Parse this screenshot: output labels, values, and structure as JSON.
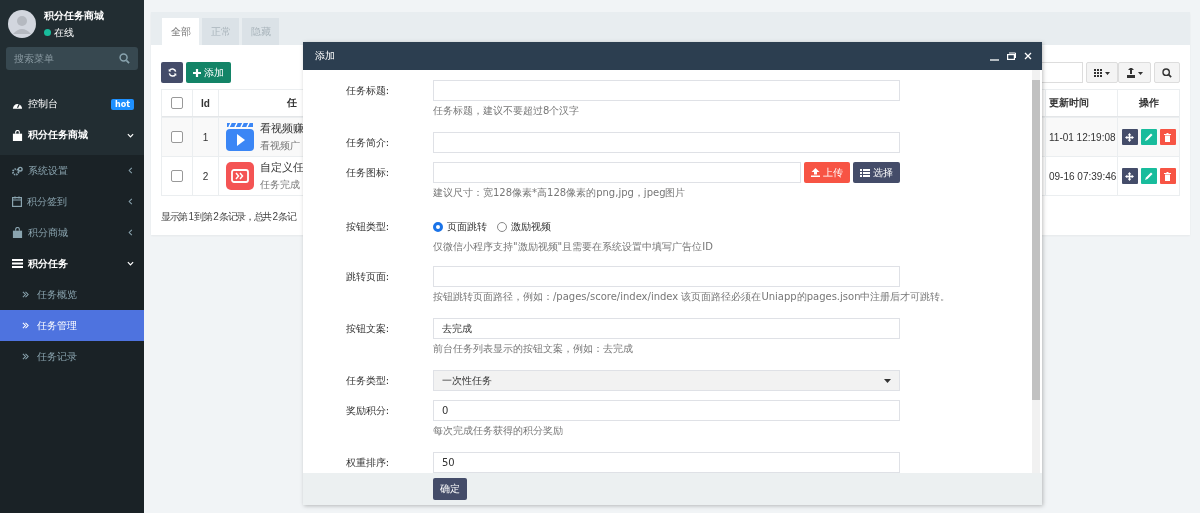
{
  "sidebar": {
    "user": {
      "name": "积分任务商城",
      "status": "在线",
      "online": true
    },
    "search": {
      "placeholder": "搜索菜单"
    },
    "menu": [
      {
        "label": "控制台",
        "badge": "hot",
        "expanded": false,
        "selected": false
      },
      {
        "label": "积分任务商城",
        "kind": "header",
        "expanded": true,
        "selected": false
      },
      {
        "label": "系统设置",
        "expanded": false,
        "selected": false
      },
      {
        "label": "积分签到",
        "expanded": false,
        "selected": false
      },
      {
        "label": "积分商城",
        "expanded": false,
        "selected": false
      },
      {
        "label": "积分任务",
        "expanded": true,
        "selected": false,
        "children": [
          {
            "label": "任务概览",
            "selected": false
          },
          {
            "label": "任务管理",
            "selected": true
          },
          {
            "label": "任务记录",
            "selected": false
          }
        ]
      }
    ]
  },
  "tabs": [
    {
      "label": "全部",
      "selected": true
    },
    {
      "label": "正常",
      "selected": false
    },
    {
      "label": "隐藏",
      "selected": false
    }
  ],
  "toolbar": {
    "add_label": "添加"
  },
  "table": {
    "header_checked": false,
    "columns": [
      "Id",
      "任",
      "更新时间",
      "操作"
    ],
    "rows": [
      {
        "checked": false,
        "id": "1",
        "title": "看视频赚",
        "desc": "看视频广",
        "time": "11-01 12:19:08",
        "kind": "video",
        "color": "#3b86f5"
      },
      {
        "checked": false,
        "id": "2",
        "title": "自定义任",
        "desc": "任务完成",
        "time": "09-16 07:39:46",
        "kind": "custom",
        "color": "#f45454"
      }
    ]
  },
  "pagination_info": "显示第 1 到第 2 条记录，总共 2 条记",
  "modal": {
    "title": "添加",
    "fields": [
      {
        "kind": "input",
        "label": "任务标题:",
        "help": "任务标题，建议不要超过8个汉字"
      },
      {
        "kind": "input",
        "label": "任务简介:"
      },
      {
        "kind": "upload",
        "label": "任务图标:",
        "buttons": [
          "上传",
          "选择"
        ],
        "help": "建议尺寸：宽128像素*高128像素的png,jpg，jpeg图片"
      },
      {
        "kind": "radio",
        "label": "按钮类型:",
        "options": [
          {
            "label": "页面跳转",
            "selected": true
          },
          {
            "label": "激励视频",
            "selected": false
          }
        ],
        "help": "仅微信小程序支持\"激励视频\"且需要在系统设置中填写广告位ID"
      },
      {
        "kind": "input",
        "label": "跳转页面:",
        "help": "按钮跳转页面路径，例如：/pages/score/index/index 该页面路径必须在Uniapp的pages.json中注册后才可跳转。"
      },
      {
        "kind": "input",
        "label": "按钮文案:",
        "value": "去完成",
        "help": "前台任务列表显示的按钮文案，例如：去完成"
      },
      {
        "kind": "select",
        "label": "任务类型:",
        "value": "一次性任务"
      },
      {
        "kind": "input",
        "label": "奖励积分:",
        "value": "0",
        "help": "每次完成任务获得的积分奖励"
      },
      {
        "kind": "input",
        "label": "权重排序:",
        "value": "50"
      }
    ],
    "submit": "确定"
  }
}
